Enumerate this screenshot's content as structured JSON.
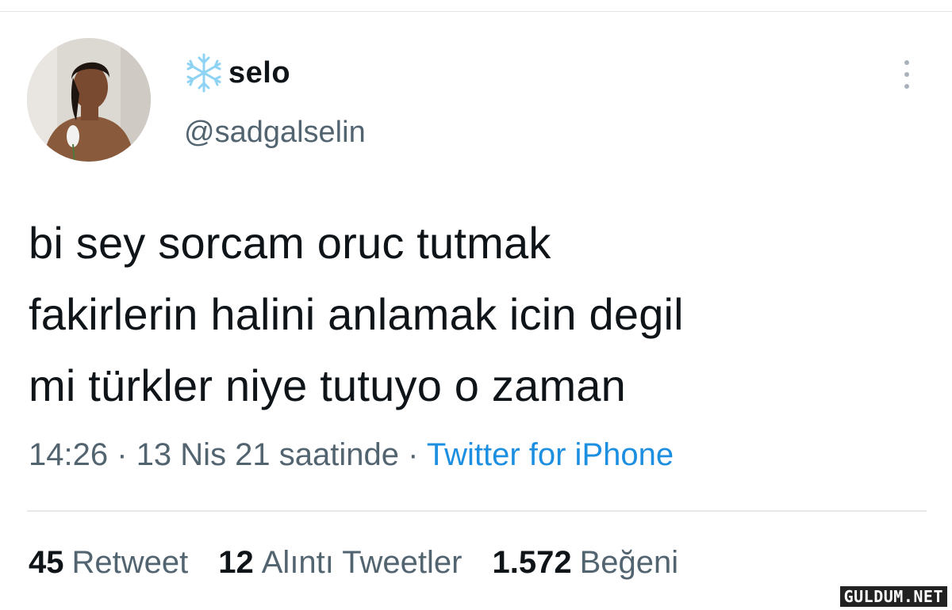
{
  "user": {
    "display_name": "selo",
    "handle": "@sadgalselin",
    "name_icon": "snowflake-icon",
    "avatar": "avatar"
  },
  "tweet": {
    "text": "bi sey sorcam oruc tutmak\nfakirlerin halini anlamak icin degil\nmi türkler niye tutuyo o zaman"
  },
  "meta": {
    "time": "14:26",
    "separator": "·",
    "date": "13 Nis 21 saatinde",
    "source": "Twitter for iPhone"
  },
  "stats": {
    "retweets_count": "45",
    "retweets_label": "Retweet",
    "quotes_count": "12",
    "quotes_label": "Alıntı Tweetler",
    "likes_count": "1.572",
    "likes_label": "Beğeni"
  },
  "watermark": "GULDUM.NET",
  "colors": {
    "text": "#0f1419",
    "muted": "#536471",
    "link": "#1d8fe1",
    "snowflake": "#8fd3f4",
    "divider": "#e6e8ea"
  }
}
